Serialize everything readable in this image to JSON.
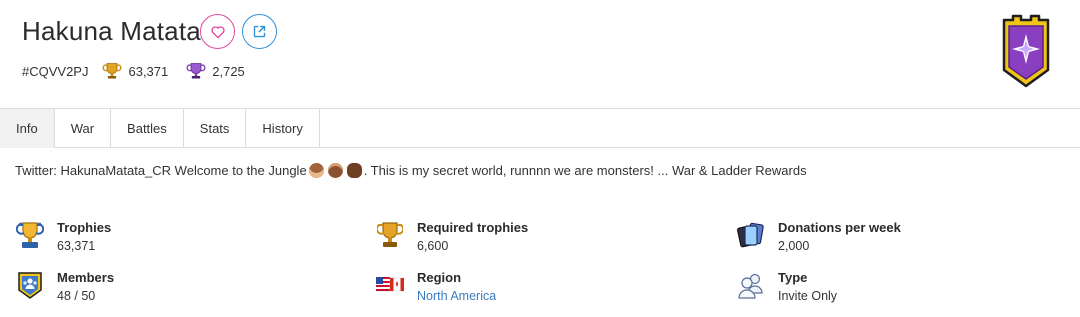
{
  "clan": {
    "name": "Hakuna Matata",
    "tag": "#CQVV2PJ",
    "trophies": "63,371",
    "war_trophies": "2,725"
  },
  "tabs": [
    {
      "label": "Info"
    },
    {
      "label": "War"
    },
    {
      "label": "Battles"
    },
    {
      "label": "Stats"
    },
    {
      "label": "History"
    }
  ],
  "description": {
    "before": "Twitter: HakunaMatata_CR Welcome to the Jungle ",
    "after": ". This is my secret world, runnnn we are monsters! ... War & Ladder Rewards"
  },
  "stats": [
    {
      "label": "Trophies",
      "value": "63,371",
      "icon": "trophy-icon"
    },
    {
      "label": "Required trophies",
      "value": "6,600",
      "icon": "trophy-icon"
    },
    {
      "label": "Donations per week",
      "value": "2,000",
      "icon": "cards-icon"
    },
    {
      "label": "Members",
      "value": "48 / 50",
      "icon": "members-icon"
    },
    {
      "label": "Region",
      "value": "North America",
      "icon": "flags-icon"
    },
    {
      "label": "Type",
      "value": "Invite Only",
      "icon": "users-icon"
    }
  ],
  "colors": {
    "favorite": "#e0479e",
    "external": "#2f8fd8",
    "link": "#3b7bbf",
    "active_tab": "#f2f2f2",
    "border": "#dcdcdc"
  }
}
